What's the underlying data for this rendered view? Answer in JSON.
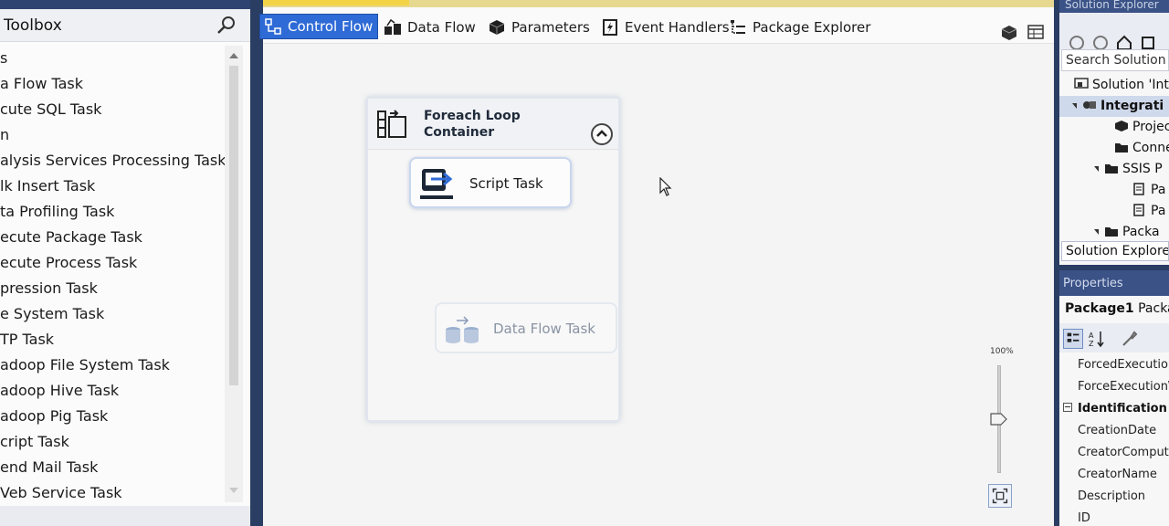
{
  "toolbox": {
    "title": "Toolbox",
    "items": [
      "s",
      "a Flow Task",
      "cute SQL Task",
      "n",
      "alysis Services Processing Task",
      "lk Insert Task",
      "ta Profiling Task",
      "ecute Package Task",
      "ecute Process Task",
      "pression Task",
      "e System Task",
      "TP Task",
      "adoop File System Task",
      "adoop Hive Task",
      "adoop Pig Task",
      "cript Task",
      "end Mail Task",
      "Veb Service Task"
    ]
  },
  "designer": {
    "tabs": {
      "control_flow": "Control Flow",
      "data_flow": "Data Flow",
      "parameters": "Parameters",
      "event_handlers": "Event Handlers",
      "package_explorer": "Package Explorer"
    },
    "container": {
      "title_line1": "Foreach Loop",
      "title_line2": "Container"
    },
    "script_task": "Script Task",
    "data_flow_task": "Data Flow Task",
    "zoom": {
      "label": "100%",
      "level_percent": 100
    }
  },
  "solution_explorer": {
    "title": "Solution Explorer",
    "search_placeholder": "Search Solution Ex",
    "tree": [
      "Solution 'Inte",
      "Integrati",
      "Projec",
      "Conne",
      "SSIS P",
      "Pa",
      "Pa",
      "Packa"
    ],
    "tab_label": "Solution Explorer"
  },
  "properties": {
    "title": "Properties",
    "object_name": "Package1",
    "object_type": "Packag",
    "rows": {
      "r1": "ForcedExecution",
      "r2": "ForceExecution\\",
      "cat": "Identification",
      "r3": "CreationDate",
      "r4": "CreatorComput",
      "r5": "CreatorName",
      "r6": "Description",
      "r7": "ID"
    }
  },
  "colors": {
    "accent": "#2f6bd6",
    "chrome": "#2a3d63",
    "connector": "#2e7d4a"
  }
}
